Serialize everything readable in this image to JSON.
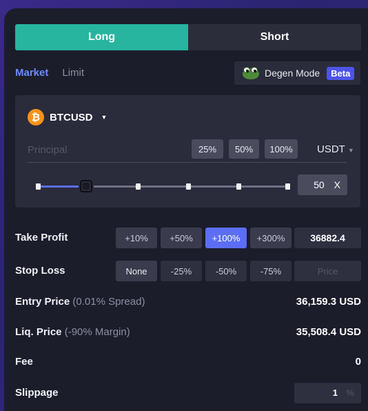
{
  "side_toggle": {
    "long": "Long",
    "short": "Short"
  },
  "order_tabs": {
    "market": "Market",
    "limit": "Limit"
  },
  "degen_mode": {
    "label": "Degen Mode",
    "badge": "Beta",
    "icon": "pepe-frog-icon"
  },
  "pair": {
    "symbol": "BTCUSD",
    "icon": "bitcoin-icon"
  },
  "principal": {
    "placeholder": "Principal",
    "value": ""
  },
  "percent_buttons": [
    "25%",
    "50%",
    "100%"
  ],
  "currency": "USDT",
  "leverage": {
    "value": "50",
    "unit": "X",
    "slider_fraction": 0.2
  },
  "take_profit": {
    "label": "Take Profit",
    "options": [
      "+10%",
      "+50%",
      "+100%",
      "+300%"
    ],
    "selected": "+100%",
    "value": "36882.4"
  },
  "stop_loss": {
    "label": "Stop Loss",
    "options": [
      "None",
      "-25%",
      "-50%",
      "-75%"
    ],
    "selected": "None",
    "price_placeholder": "Price"
  },
  "entry_price": {
    "label": "Entry Price",
    "note": "(0.01% Spread)",
    "value": "36,159.3 USD"
  },
  "liq_price": {
    "label": "Liq. Price",
    "note": "(-90% Margin)",
    "value": "35,508.4 USD"
  },
  "fee": {
    "label": "Fee",
    "value": "0"
  },
  "slippage": {
    "label": "Slippage",
    "value": "1",
    "unit": "%"
  },
  "colors": {
    "long": "#27b5a0",
    "accent": "#5b6ef5",
    "bitcoin": "#f7931a",
    "beta": "#4d54e8"
  }
}
